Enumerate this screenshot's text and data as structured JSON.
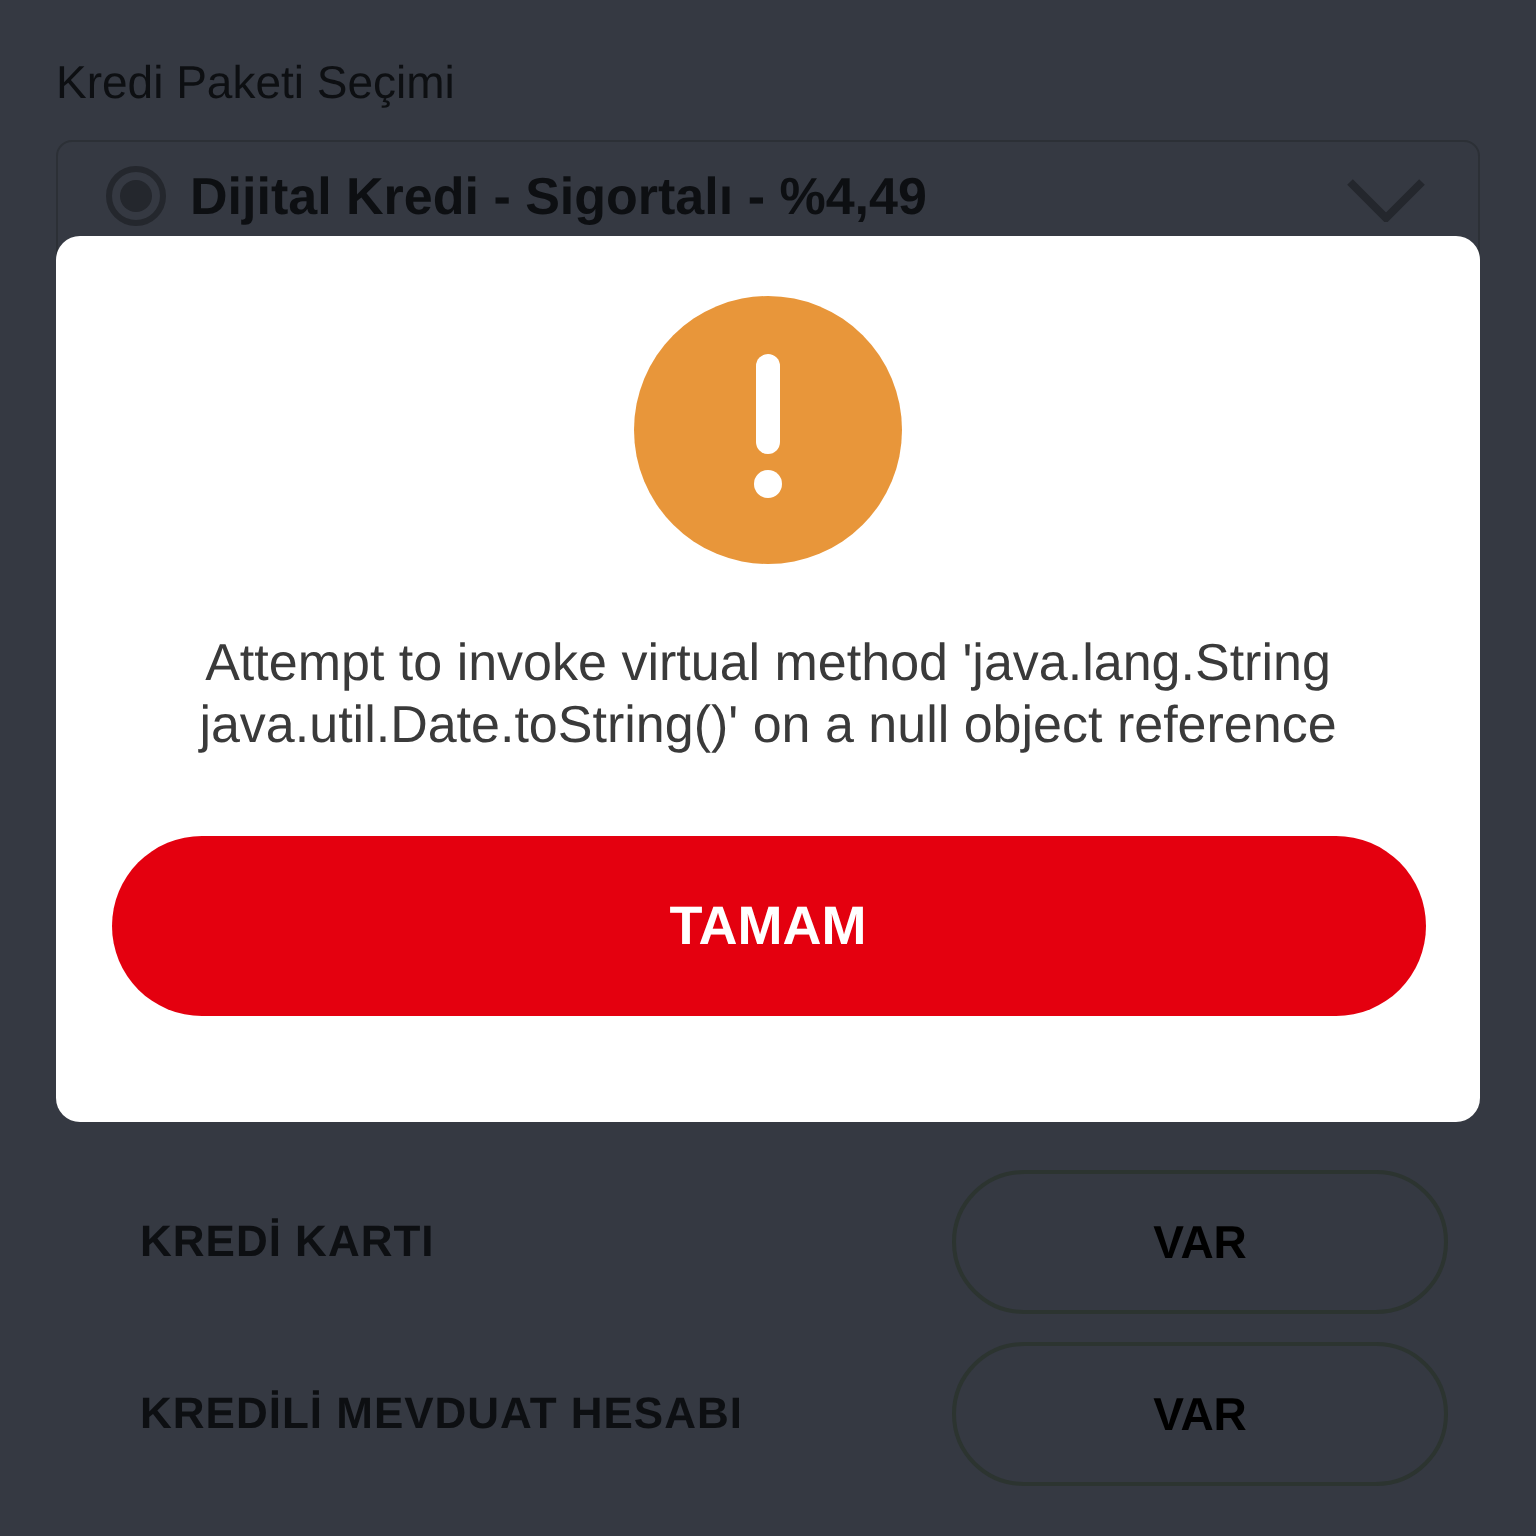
{
  "background": {
    "section_title": "Kredi Paketi Seçimi",
    "package_select": {
      "value": "Dijital Kredi - Sigortalı - %4,49",
      "selected": true
    },
    "products": [
      {
        "label": "KREDİ KARTI",
        "answer": "VAR"
      },
      {
        "label": "KREDİLİ MEVDUAT HESABI",
        "answer": "VAR"
      }
    ]
  },
  "dialog": {
    "message": "Attempt to invoke virtual method 'java.lang.String java.util.Date.toString()' on a null object reference",
    "button": "TAMAM"
  }
}
